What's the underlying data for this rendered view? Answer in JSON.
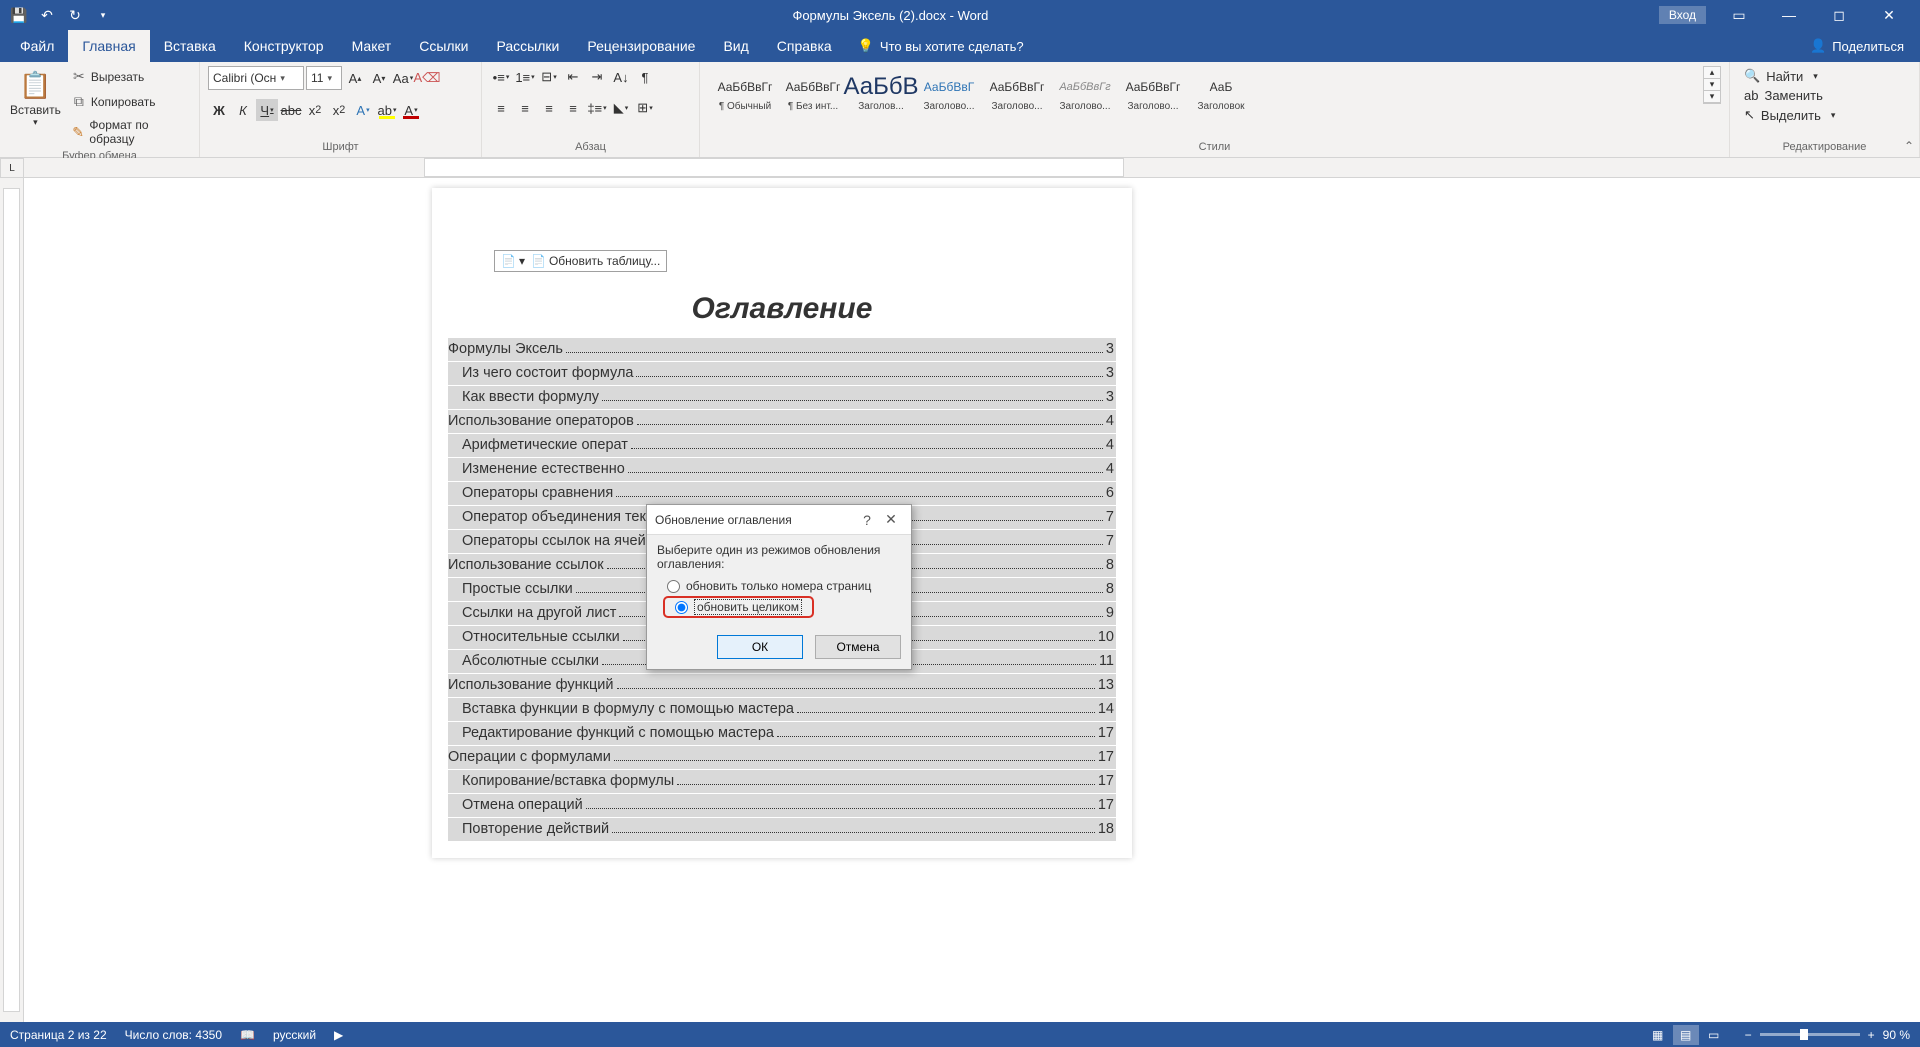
{
  "titlebar": {
    "title": "Формулы Эксель (2).docx - Word",
    "login": "Вход"
  },
  "tabs": {
    "file": "Файл",
    "home": "Главная",
    "insert": "Вставка",
    "design": "Конструктор",
    "layout": "Макет",
    "references": "Ссылки",
    "mailings": "Рассылки",
    "review": "Рецензирование",
    "view": "Вид",
    "help": "Справка",
    "tellme": "Что вы хотите сделать?",
    "share": "Поделиться"
  },
  "ribbon": {
    "clipboard": {
      "label": "Буфер обмена",
      "paste": "Вставить",
      "cut": "Вырезать",
      "copy": "Копировать",
      "format_painter": "Формат по образцу"
    },
    "font": {
      "label": "Шрифт",
      "name": "Calibri (Осн",
      "size": "11"
    },
    "paragraph": {
      "label": "Абзац"
    },
    "styles": {
      "label": "Стили",
      "items": [
        {
          "preview": "АаБбВвГг",
          "name": "¶ Обычный"
        },
        {
          "preview": "АаБбВвГг",
          "name": "¶ Без инт..."
        },
        {
          "preview": "АаБбВ",
          "name": "Заголов..."
        },
        {
          "preview": "АаБбВвГ",
          "name": "Заголово..."
        },
        {
          "preview": "АаБбВвГг",
          "name": "Заголово..."
        },
        {
          "preview": "АаБбВвГг",
          "name": "Заголово..."
        },
        {
          "preview": "АаБбВвГг",
          "name": "Заголово..."
        },
        {
          "preview": "АаБ",
          "name": "Заголовок"
        }
      ]
    },
    "editing": {
      "label": "Редактирование",
      "find": "Найти",
      "replace": "Заменить",
      "select": "Выделить"
    }
  },
  "toc_tab": {
    "update": "Обновить таблицу..."
  },
  "doc": {
    "title": "Оглавление",
    "lines": [
      {
        "lvl": 1,
        "text": "Формулы Эксель",
        "pg": "3"
      },
      {
        "lvl": 2,
        "text": "Из чего состоит формула",
        "pg": "3"
      },
      {
        "lvl": 2,
        "text": "Как ввести формулу",
        "pg": "3"
      },
      {
        "lvl": 1,
        "text": "Использование операторов",
        "pg": "4"
      },
      {
        "lvl": 2,
        "text": "Арифметические операт",
        "pg": "4"
      },
      {
        "lvl": 2,
        "text": "Изменение естественно",
        "pg": "4"
      },
      {
        "lvl": 2,
        "text": "Операторы сравнения",
        "pg": "6"
      },
      {
        "lvl": 2,
        "text": "Оператор объединения текста",
        "pg": "7"
      },
      {
        "lvl": 2,
        "text": "Операторы ссылок на ячейки",
        "pg": "7"
      },
      {
        "lvl": 1,
        "text": "Использование ссылок",
        "pg": "8"
      },
      {
        "lvl": 2,
        "text": "Простые ссылки",
        "pg": "8"
      },
      {
        "lvl": 2,
        "text": "Ссылки на другой лист",
        "pg": "9"
      },
      {
        "lvl": 2,
        "text": "Относительные ссылки",
        "pg": "10"
      },
      {
        "lvl": 2,
        "text": "Абсолютные ссылки",
        "pg": "11"
      },
      {
        "lvl": 1,
        "text": "Использование функций",
        "pg": "13"
      },
      {
        "lvl": 2,
        "text": "Вставка функции в формулу с помощью мастера",
        "pg": "14"
      },
      {
        "lvl": 2,
        "text": "Редактирование функций с помощью мастера",
        "pg": "17"
      },
      {
        "lvl": 1,
        "text": "Операции с формулами",
        "pg": "17"
      },
      {
        "lvl": 2,
        "text": "Копирование/вставка формулы",
        "pg": "17"
      },
      {
        "lvl": 2,
        "text": "Отмена операций",
        "pg": "17"
      },
      {
        "lvl": 2,
        "text": "Повторение действий",
        "pg": "18"
      }
    ]
  },
  "dialog": {
    "title": "Обновление оглавления",
    "instruction": "Выберите один из режимов обновления оглавления:",
    "opt_pages": "обновить только номера страниц",
    "opt_all": "обновить целиком",
    "ok": "ОК",
    "cancel": "Отмена"
  },
  "statusbar": {
    "page": "Страница 2 из 22",
    "words": "Число слов: 4350",
    "lang": "русский",
    "zoom": "90 %"
  }
}
